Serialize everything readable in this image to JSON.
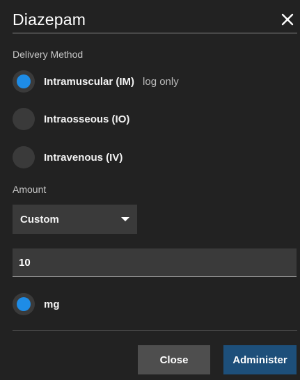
{
  "dialog": {
    "title": "Diazepam",
    "close_icon": "close-icon"
  },
  "delivery": {
    "label": "Delivery Method",
    "options": [
      {
        "label": "Intramuscular (IM)",
        "hint": "log only",
        "checked": true
      },
      {
        "label": "Intraosseous (IO)",
        "hint": "",
        "checked": false
      },
      {
        "label": "Intravenous (IV)",
        "hint": "",
        "checked": false
      }
    ]
  },
  "amount": {
    "label": "Amount",
    "select_value": "Custom",
    "input_value": "10",
    "unit": {
      "label": "mg",
      "checked": true
    }
  },
  "footer": {
    "close_label": "Close",
    "administer_label": "Administer"
  },
  "colors": {
    "background": "#222222",
    "control": "#3a3a3a",
    "accent": "#1e8ce6",
    "primary_button": "#1d4f7a",
    "secondary_button": "#4e4e4e"
  }
}
